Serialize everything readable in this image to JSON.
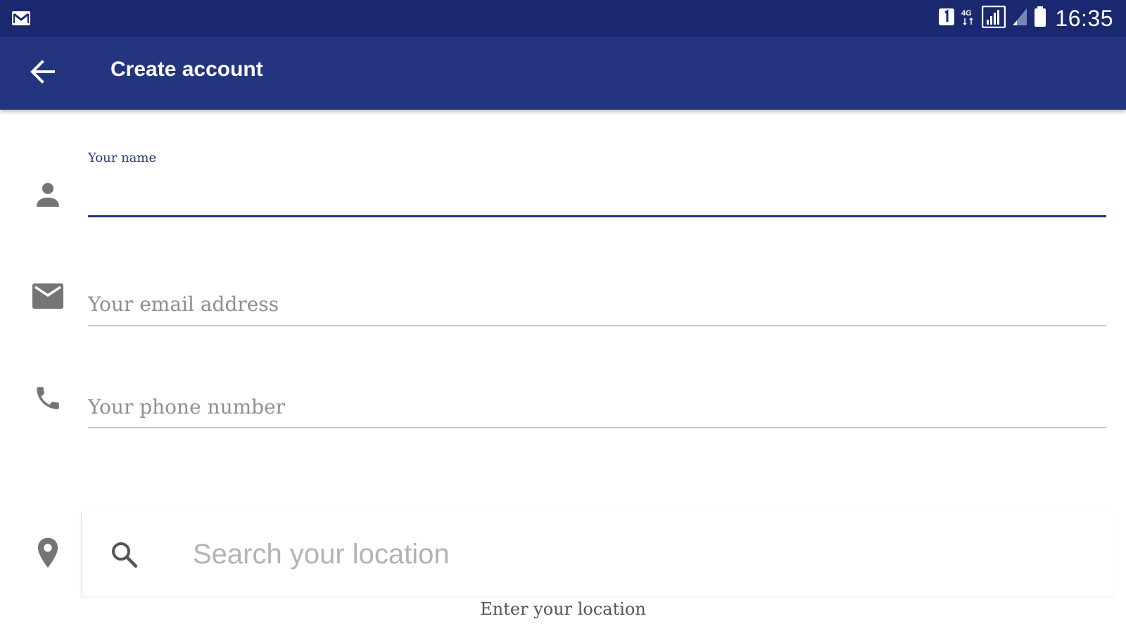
{
  "status_bar": {
    "time": "16:35",
    "icons": [
      "gmail-notification-icon",
      "notification-badge-icon",
      "4g-icon",
      "signal-icon",
      "signal-weak-icon",
      "battery-icon"
    ]
  },
  "app_bar": {
    "title": "Create account",
    "back_icon": "arrow-back-icon"
  },
  "form": {
    "name": {
      "label": "Your name",
      "value": "",
      "icon": "person-icon"
    },
    "email": {
      "placeholder": "Your email address",
      "value": "",
      "icon": "email-icon"
    },
    "phone": {
      "placeholder": "Your phone number",
      "value": "",
      "icon": "phone-icon"
    },
    "location": {
      "placeholder": "Search your location",
      "value": "",
      "helper": "Enter your location",
      "icon": "location-pin-icon",
      "search_icon": "search-icon"
    }
  },
  "colors": {
    "status_bar": "#19286f",
    "app_bar": "#23357e",
    "accent": "#23357e",
    "icon_gray": "#757575",
    "divider": "#c8c8c8"
  }
}
